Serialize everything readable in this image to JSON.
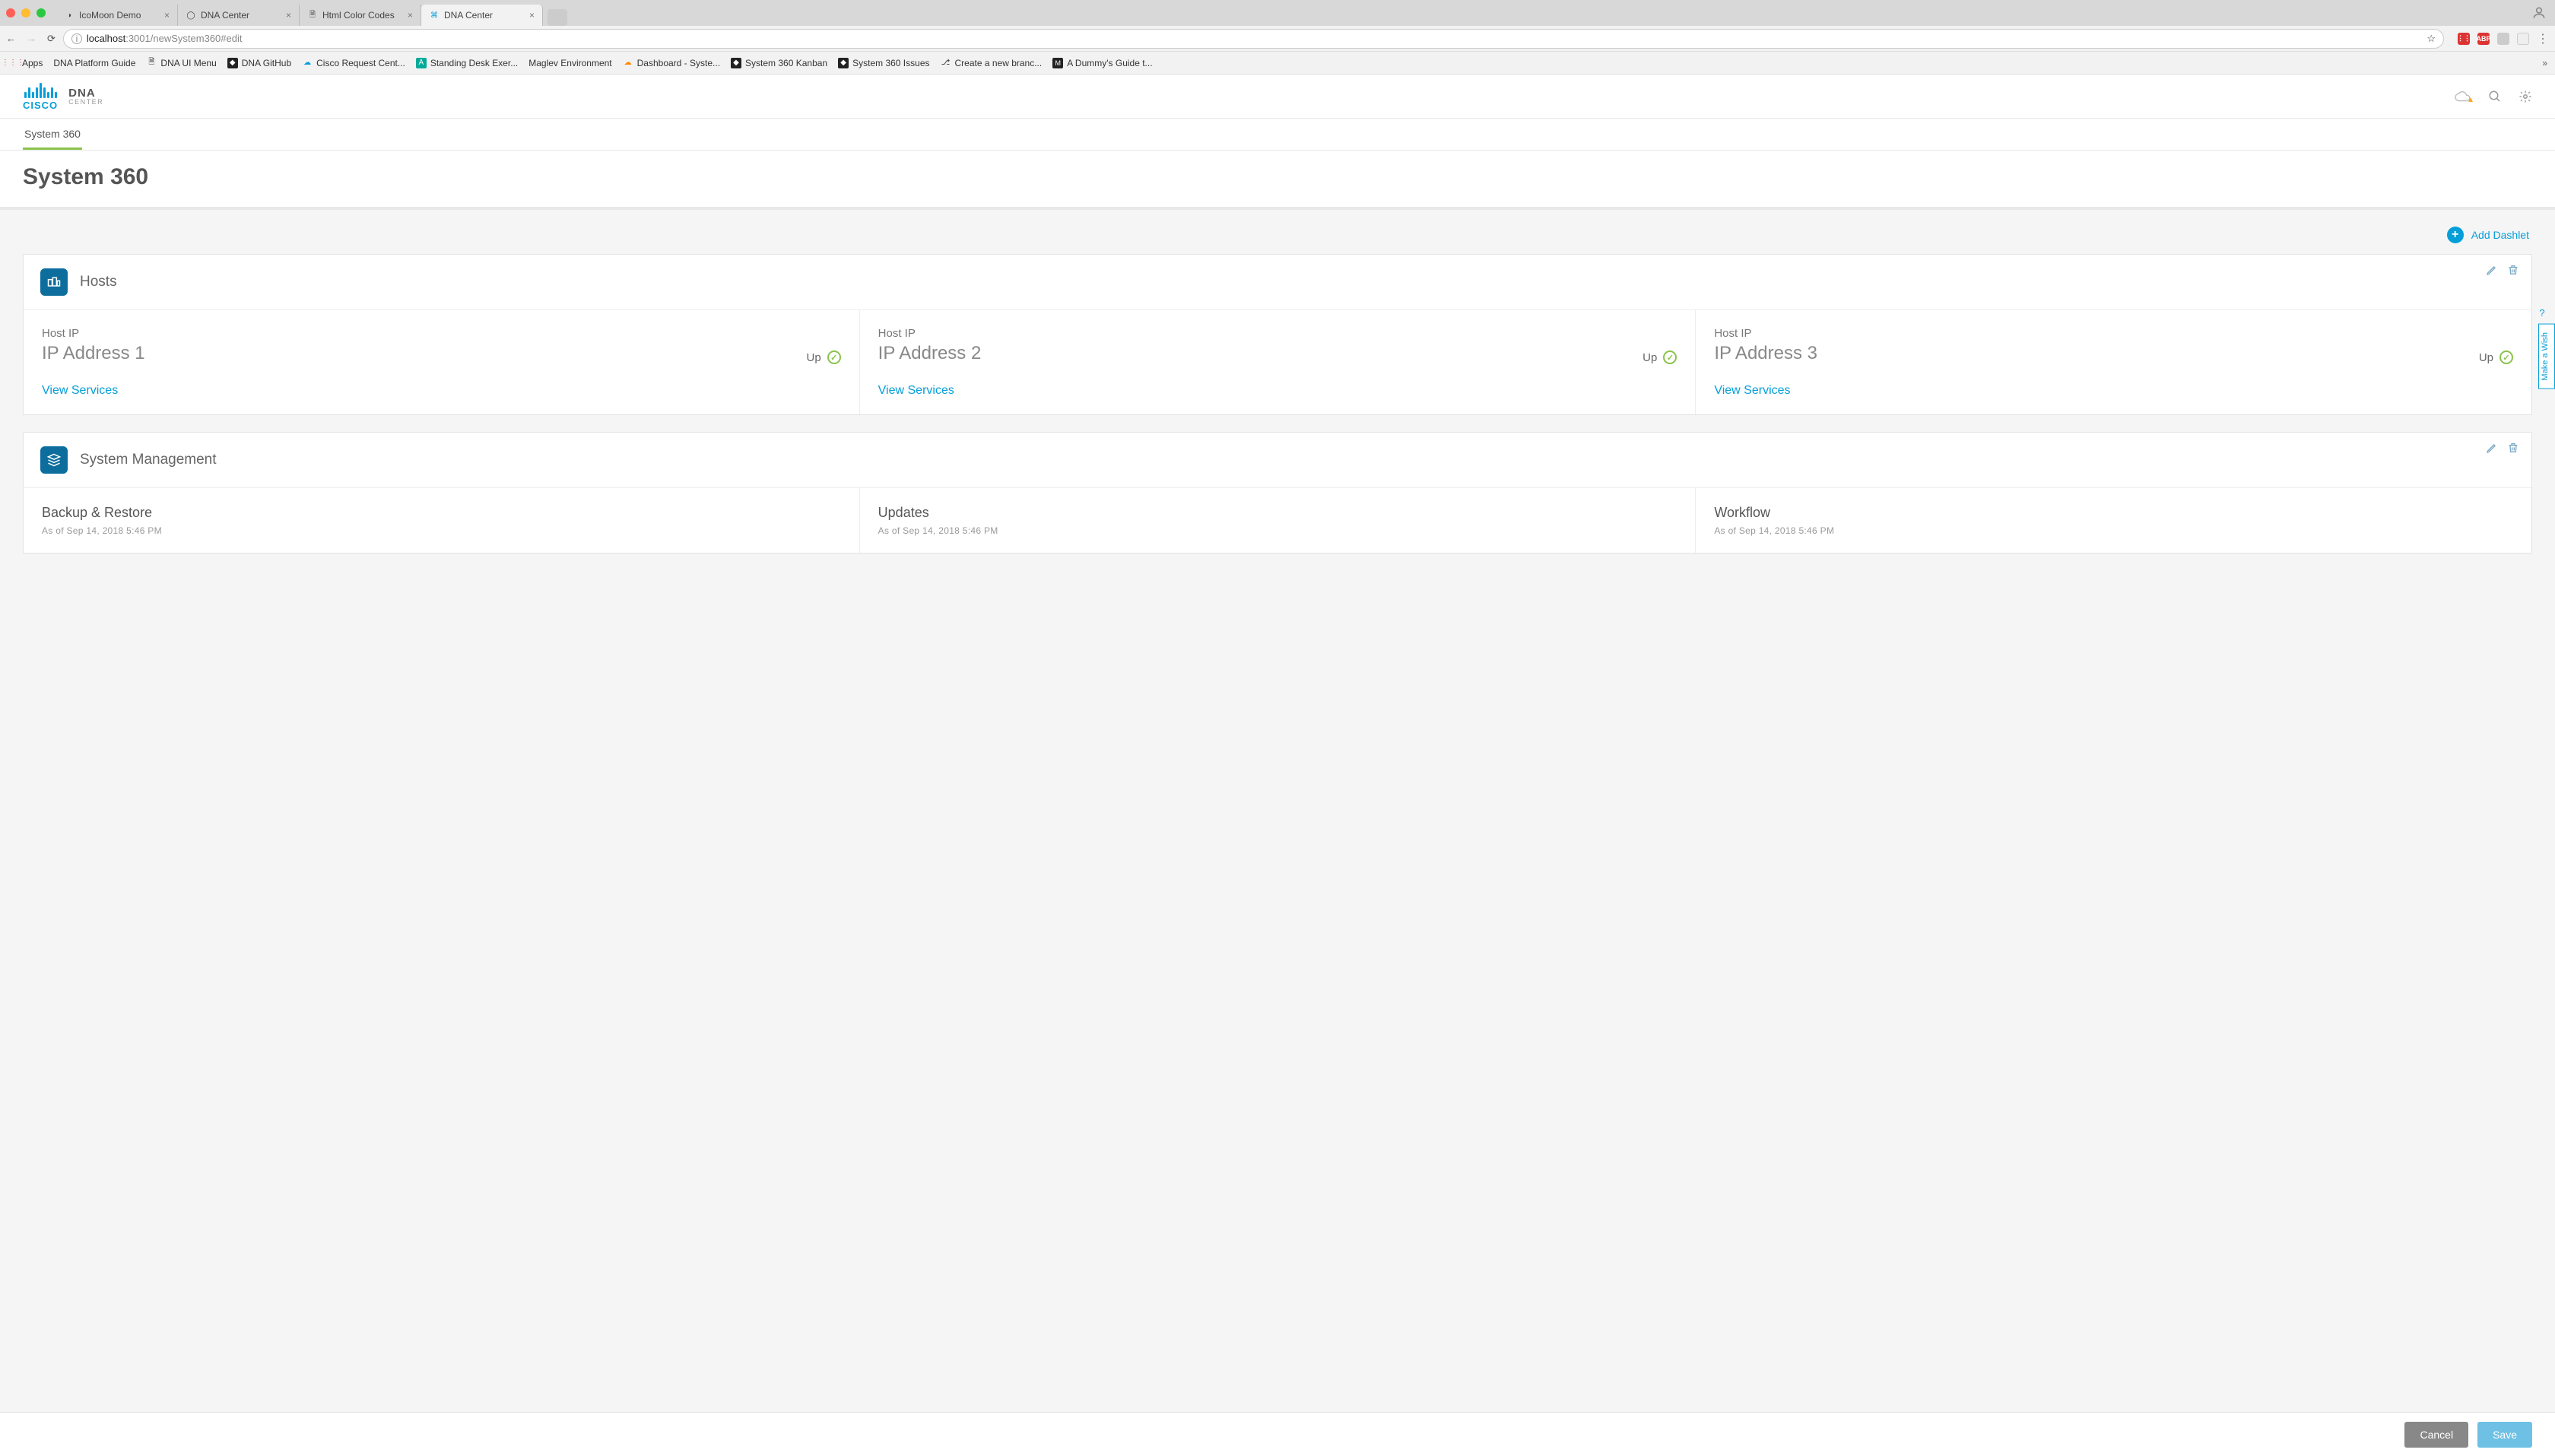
{
  "browser": {
    "tabs": [
      {
        "title": "IcoMoon Demo"
      },
      {
        "title": "DNA Center"
      },
      {
        "title": "Html Color Codes"
      },
      {
        "title": "DNA Center"
      }
    ],
    "url_host": "localhost",
    "url_port": ":3001",
    "url_path": "/newSystem360#edit",
    "bookmarks": [
      "Apps",
      "DNA Platform Guide",
      "DNA UI Menu",
      "DNA GitHub",
      "Cisco Request Cent...",
      "Standing Desk Exer...",
      "Maglev Environment",
      "Dashboard - Syste...",
      "System 360 Kanban",
      "System 360 Issues",
      "Create a new branc...",
      "A Dummy's Guide t..."
    ]
  },
  "header": {
    "brand_primary": "CISCO",
    "brand_line1": "DNA",
    "brand_line2": "CENTER"
  },
  "pageTabs": {
    "active": "System 360"
  },
  "pageTitle": "System 360",
  "addDashlet": "Add Dashlet",
  "dashlets": {
    "hosts": {
      "title": "Hosts",
      "cells": [
        {
          "label": "Host IP",
          "value": "IP Address 1",
          "status": "Up",
          "link": "View Services"
        },
        {
          "label": "Host IP",
          "value": "IP Address 2",
          "status": "Up",
          "link": "View Services"
        },
        {
          "label": "Host IP",
          "value": "IP Address 3",
          "status": "Up",
          "link": "View Services"
        }
      ]
    },
    "mgmt": {
      "title": "System Management",
      "cells": [
        {
          "title": "Backup & Restore",
          "sub": "As of Sep 14, 2018 5:46 PM"
        },
        {
          "title": "Updates",
          "sub": "As of Sep 14, 2018 5:46 PM"
        },
        {
          "title": "Workflow",
          "sub": "As of Sep 14, 2018 5:46 PM"
        }
      ]
    }
  },
  "footer": {
    "cancel": "Cancel",
    "save": "Save"
  },
  "side": {
    "help": "?",
    "wish": "Make a Wish"
  }
}
